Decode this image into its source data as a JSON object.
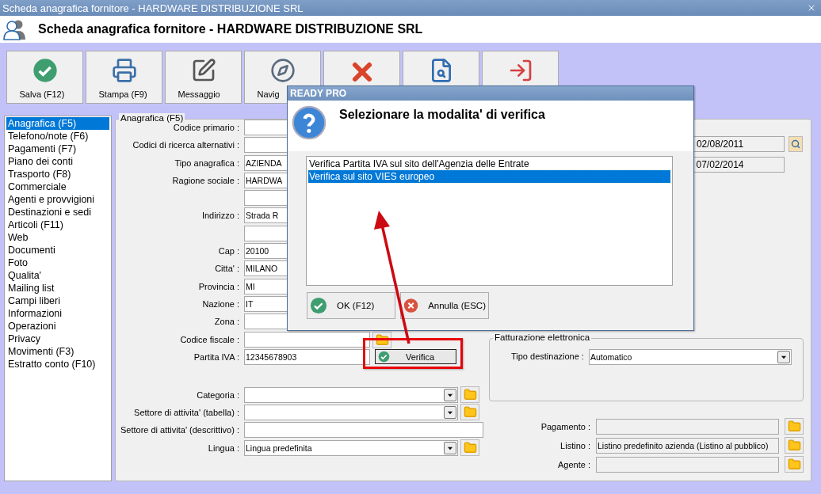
{
  "window": {
    "title": "Scheda anagrafica fornitore - HARDWARE DISTRIBUZIONE SRL"
  },
  "header": {
    "title": "Scheda anagrafica fornitore - HARDWARE DISTRIBUZIONE SRL"
  },
  "toolbar": [
    {
      "kind": "save",
      "label": "Salva (F12)"
    },
    {
      "kind": "print",
      "label": "Stampa (F9)"
    },
    {
      "kind": "message",
      "label": "Messaggio"
    },
    {
      "kind": "navigate",
      "label": "Navig"
    },
    {
      "kind": "delete"
    },
    {
      "kind": "search"
    },
    {
      "kind": "exit"
    }
  ],
  "sidebar": {
    "items": [
      {
        "label": "Anagrafica (F5)",
        "selected": true
      },
      {
        "label": "Telefono/note (F6)",
        "selected": false
      },
      {
        "label": "Pagamenti (F7)",
        "selected": false
      },
      {
        "label": "Piano dei conti",
        "selected": false
      },
      {
        "label": "Trasporto (F8)",
        "selected": false
      },
      {
        "label": "Commerciale",
        "selected": false
      },
      {
        "label": "Agenti e provvigioni",
        "selected": false
      },
      {
        "label": "Destinazioni e sedi",
        "selected": false
      },
      {
        "label": "Articoli (F11)",
        "selected": false
      },
      {
        "label": "Web",
        "selected": false
      },
      {
        "label": "Documenti",
        "selected": false
      },
      {
        "label": "Foto",
        "selected": false
      },
      {
        "label": "Qualita'",
        "selected": false
      },
      {
        "label": "Mailing list",
        "selected": false
      },
      {
        "label": "Campi liberi",
        "selected": false
      },
      {
        "label": "Informazioni",
        "selected": false
      },
      {
        "label": "Operazioni",
        "selected": false
      },
      {
        "label": "Privacy",
        "selected": false
      },
      {
        "label": "Movimenti (F3)",
        "selected": false
      },
      {
        "label": "Estratto conto (F10)",
        "selected": false
      }
    ]
  },
  "form": {
    "legend": "Anagrafica (F5)",
    "fields": [
      {
        "label": "Codice primario :",
        "kind": "text"
      },
      {
        "label": "Codici di ricerca alternativi :",
        "kind": "text"
      },
      {
        "label": "Tipo anagrafica :",
        "kind": "text",
        "value": "AZIENDA"
      },
      {
        "label": "Ragione sociale :",
        "kind": "text",
        "value": "HARDWA"
      },
      {
        "kind": "text"
      },
      {
        "label": "Indirizzo :",
        "kind": "text",
        "value": "Strada R"
      },
      {
        "kind": "text"
      },
      {
        "label": "Cap :",
        "kind": "text",
        "value": "20100"
      },
      {
        "label": "Citta' :",
        "kind": "text",
        "value": "MILANO"
      },
      {
        "label": "Provincia :",
        "kind": "text",
        "value": "MI"
      },
      {
        "label": "Nazione :",
        "kind": "text",
        "value": "IT"
      },
      {
        "label": "Zona :",
        "kind": "text"
      },
      {
        "label": "Codice fiscale :",
        "kind": "text",
        "folder": true
      },
      {
        "label": "Partita IVA :",
        "kind": "text",
        "value": "12345678903",
        "verify": "Verifica"
      },
      {
        "label": "Categoria :",
        "kind": "select",
        "wide": true,
        "folder": true
      },
      {
        "label": "Settore di attivita' (tabella) :",
        "kind": "select",
        "wide": true,
        "folder": true
      },
      {
        "label": "Settore di attivita' (descrittivo) :",
        "kind": "text",
        "wide": true
      },
      {
        "label": "Lingua :",
        "kind": "select",
        "wide": true,
        "folder": true,
        "value": "Lingua predefinita"
      }
    ],
    "dates": [
      {
        "value": "02/08/2011",
        "lookup": true
      },
      {
        "value": "07/02/2014",
        "lookup": false
      }
    ],
    "invoicing": {
      "legend": "Fatturazione elettronica",
      "label": "Tipo destinazione :",
      "value": "Automatico"
    },
    "links": [
      {
        "label": "Pagamento :"
      },
      {
        "label": "Listino :",
        "value": "Listino predefinito azienda (Listino al pubblico)"
      },
      {
        "label": "Agente :"
      }
    ]
  },
  "dialog": {
    "title": "READY PRO",
    "message": "Selezionare la modalita' di verifica",
    "options": [
      {
        "label": "Verifica Partita IVA sul sito dell'Agenzia delle Entrate",
        "selected": false
      },
      {
        "label": "Verifica sul sito VIES europeo",
        "selected": true
      }
    ],
    "buttons": [
      {
        "kind": "ok",
        "label": "OK (F12)"
      },
      {
        "kind": "cancel",
        "label": "Annulla (ESC)"
      }
    ]
  }
}
